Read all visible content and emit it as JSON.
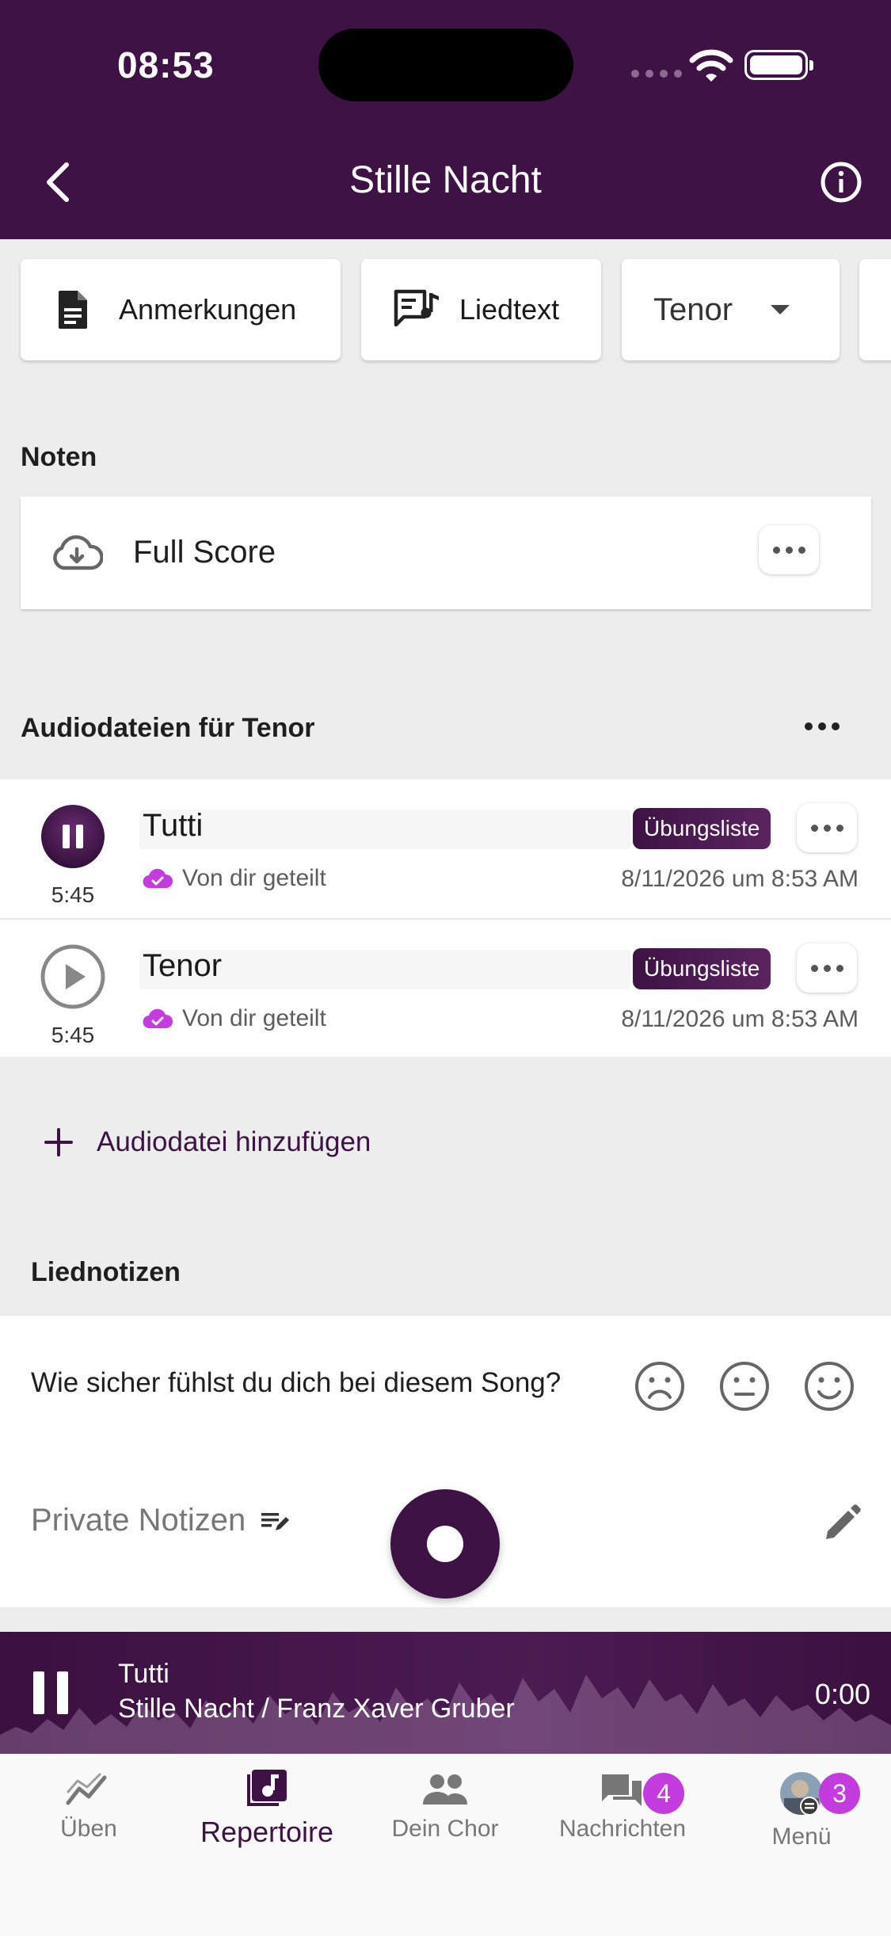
{
  "status_bar": {
    "time": "08:53"
  },
  "header": {
    "title": "Stille Nacht"
  },
  "chips": {
    "annotations": "Anmerkungen",
    "lyrics": "Liedtext",
    "voice": "Tenor"
  },
  "noten": {
    "section_title": "Noten",
    "file": "Full Score"
  },
  "audio": {
    "section_title": "Audiodateien für Tenor",
    "items": [
      {
        "title": "Tutti",
        "badge": "Übungsliste",
        "duration": "5:45",
        "shared": "Von dir geteilt",
        "date": "8/11/2026 um 8:53 AM",
        "state": "playing"
      },
      {
        "title": "Tenor",
        "badge": "Übungsliste",
        "duration": "5:45",
        "shared": "Von dir geteilt",
        "date": "8/11/2026 um 8:53 AM",
        "state": "paused"
      }
    ],
    "add_label": "Audiodatei hinzufügen"
  },
  "liednotizen": {
    "section_title": "Liednotizen",
    "question": "Wie sicher fühlst du dich bei diesem Song?",
    "private_label": "Private Notizen"
  },
  "player": {
    "title": "Tutti",
    "subtitle": "Stille Nacht / Franz Xaver Gruber",
    "time": "0:00"
  },
  "tabs": [
    {
      "label": "Üben",
      "icon": "chart-line-icon"
    },
    {
      "label": "Repertoire",
      "icon": "music-note-icon",
      "active": true
    },
    {
      "label": "Dein Chor",
      "icon": "people-icon"
    },
    {
      "label": "Nachrichten",
      "icon": "chat-icon",
      "badge": "4"
    },
    {
      "label": "Menü",
      "icon": "avatar",
      "badge": "3"
    }
  ],
  "colors": {
    "brand": "#3e1244",
    "accent": "#c43be0",
    "background": "#ededed"
  }
}
